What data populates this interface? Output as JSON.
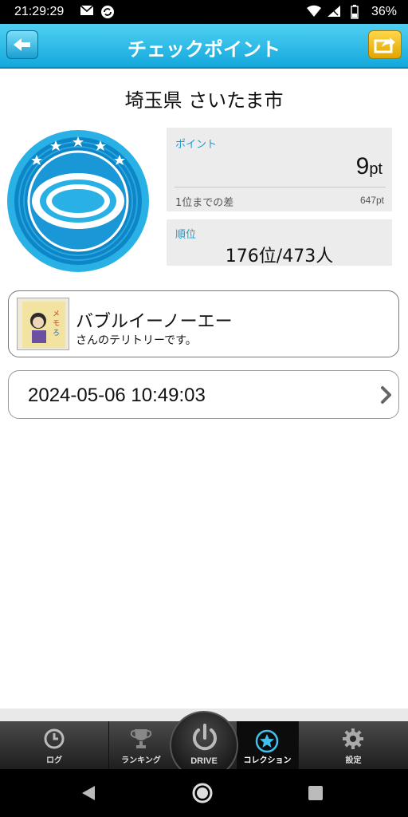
{
  "status_bar": {
    "time": "21:29:29",
    "battery": "36%",
    "icons": [
      "mail-icon",
      "sync-icon",
      "wifi-icon",
      "signal-icon",
      "battery-icon"
    ]
  },
  "header": {
    "title": "チェックポイント",
    "back_icon": "arrow-left-icon",
    "share_icon": "share-icon",
    "colors": {
      "bar": "#14a8dc",
      "share": "#f0b800"
    }
  },
  "city_title": "埼玉県 さいたま市",
  "badge": {
    "icon": "checkpoint-badge-icon",
    "colors": [
      "#29b1e6",
      "#0d86c7"
    ]
  },
  "points": {
    "label": "ポイント",
    "value": "9",
    "unit": "pt",
    "gap_label": "1位までの差",
    "gap_value": "647pt"
  },
  "rank": {
    "label": "順位",
    "value": "176位/473人"
  },
  "territory": {
    "owner_name": "バブルイーノーエー",
    "subtitle": "さんのテリトリーです。"
  },
  "date_row": {
    "datetime": "2024-05-06 10:49:03",
    "icon": "chevron-right-icon"
  },
  "tabs": [
    {
      "label": "ログ",
      "icon": "clock-icon"
    },
    {
      "label": "ランキング",
      "icon": "trophy-icon"
    },
    {
      "label": "DRIVE",
      "icon": "power-icon"
    },
    {
      "label": "コレクション",
      "icon": "star-icon",
      "active": true
    },
    {
      "label": "設定",
      "icon": "gear-icon"
    }
  ],
  "nav_bar": {
    "icons": [
      "back-triangle-icon",
      "home-circle-icon",
      "recents-square-icon"
    ]
  }
}
